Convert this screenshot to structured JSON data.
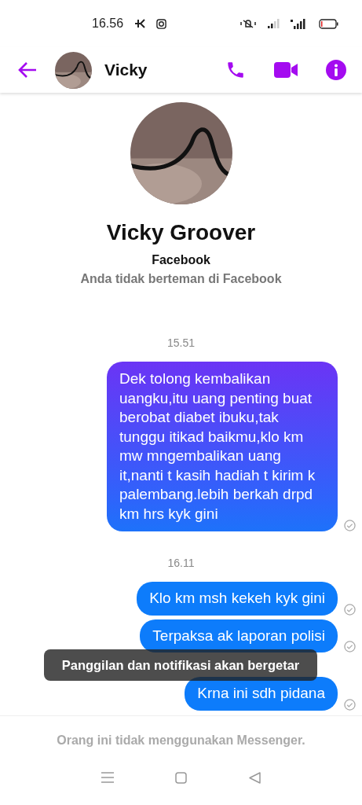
{
  "status_bar": {
    "time": "16.56"
  },
  "header": {
    "name": "Vicky"
  },
  "profile": {
    "name": "Vicky Groover",
    "source": "Facebook",
    "relation": "Anda tidak berteman di Facebook"
  },
  "thread": [
    {
      "kind": "time",
      "text": "15.51"
    },
    {
      "kind": "message",
      "text": "Dek tolong kembalikan uangku,itu uang penting buat berobat diabet ibuku,tak tunggu itikad baikmu,klo km mw mngembalikan uang it,nanti t kasih hadiah t kirim k palembang.lebih berkah drpd km hrs kyk gini",
      "sent": true
    },
    {
      "kind": "time",
      "text": "16.11"
    },
    {
      "kind": "message",
      "text": "Klo km msh kekeh kyk gini",
      "sent": true
    },
    {
      "kind": "message",
      "text": "Terpaksa ak laporan polisi",
      "sent": true
    },
    {
      "kind": "message",
      "text": "Krna ini sdh pidana",
      "sent": true
    }
  ],
  "toast": "Panggilan dan notifikasi akan bergetar",
  "footer": "Orang ini tidak menggunakan Messenger."
}
